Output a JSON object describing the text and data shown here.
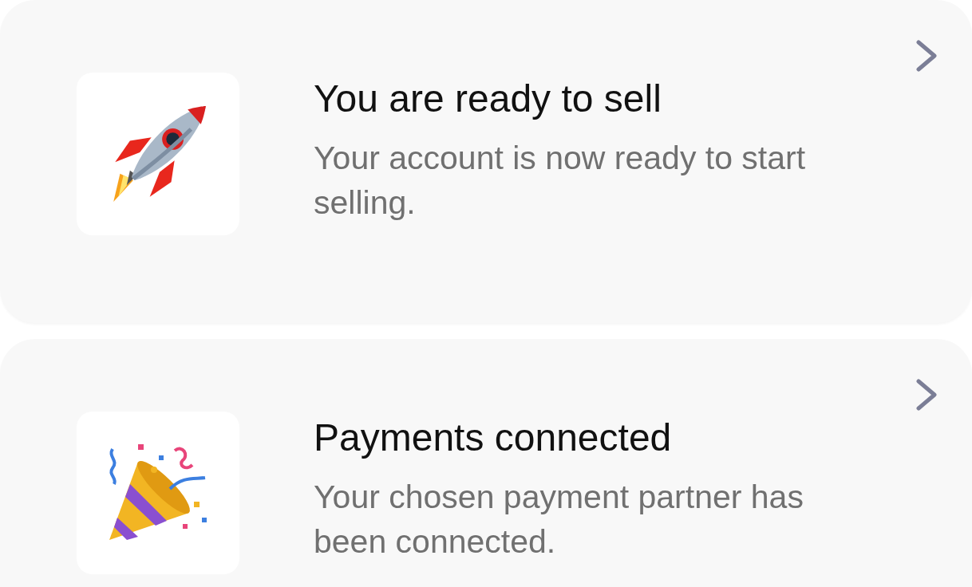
{
  "cards": [
    {
      "kind": "rocket",
      "title": "You are ready to sell",
      "description": "Your account is now ready to start selling."
    },
    {
      "kind": "popper",
      "title": "Payments connected",
      "description": "Your chosen payment partner has been connected."
    }
  ]
}
